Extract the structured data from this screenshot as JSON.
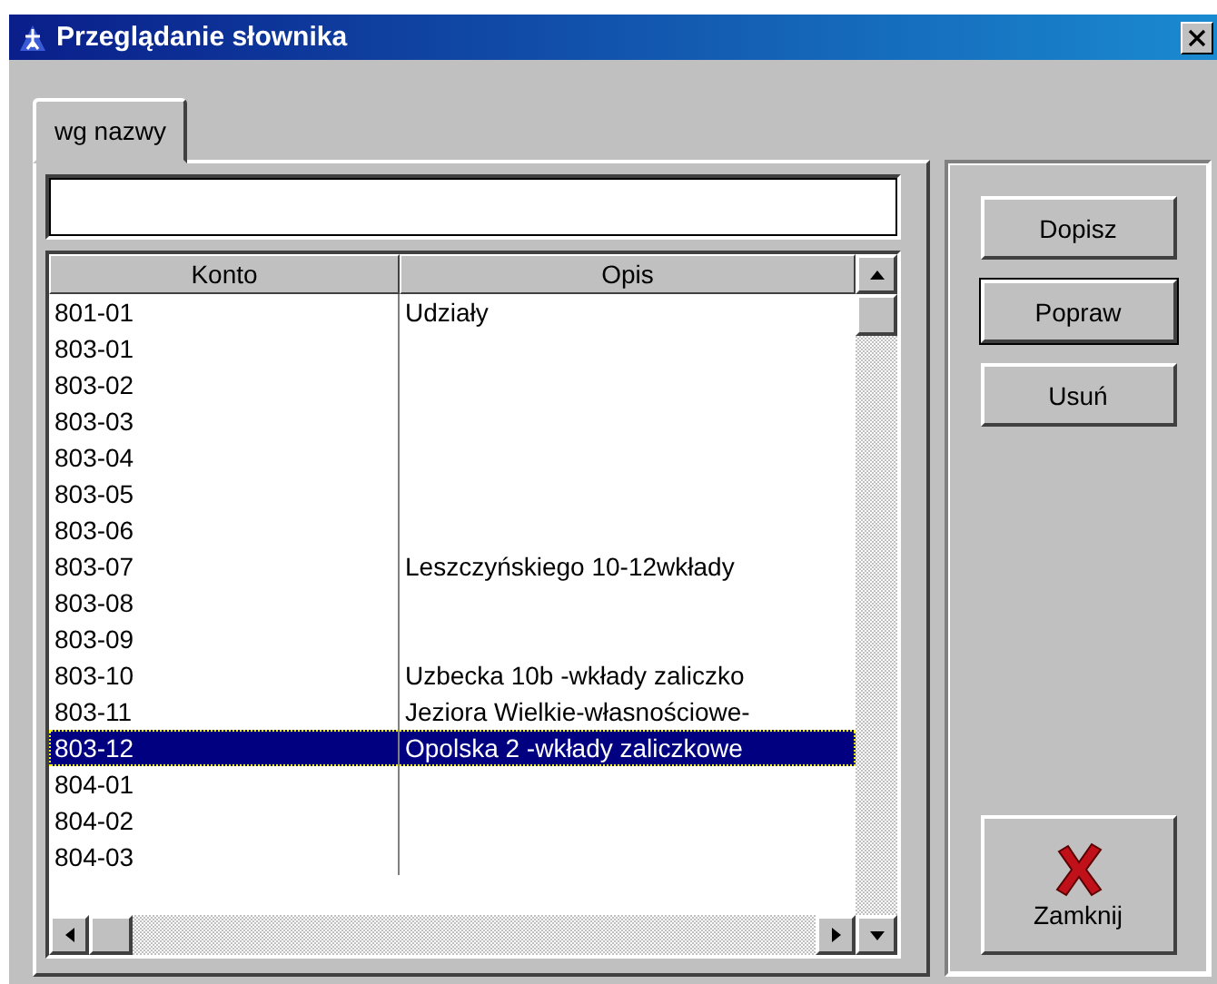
{
  "window": {
    "title": "Przeglądanie słownika"
  },
  "tabs": [
    {
      "label": "wg nazwy",
      "selected": true
    }
  ],
  "table": {
    "columns": [
      "Konto",
      "Opis"
    ],
    "rows": [
      {
        "konto": "801-01",
        "opis": "Udziały",
        "selected": false
      },
      {
        "konto": "803-01",
        "opis": "",
        "selected": false
      },
      {
        "konto": "803-02",
        "opis": "",
        "selected": false
      },
      {
        "konto": "803-03",
        "opis": "",
        "selected": false
      },
      {
        "konto": "803-04",
        "opis": "",
        "selected": false
      },
      {
        "konto": "803-05",
        "opis": "",
        "selected": false
      },
      {
        "konto": "803-06",
        "opis": "",
        "selected": false
      },
      {
        "konto": "803-07",
        "opis": "Leszczyńskiego 10-12wkłady",
        "selected": false
      },
      {
        "konto": "803-08",
        "opis": "",
        "selected": false
      },
      {
        "konto": "803-09",
        "opis": "",
        "selected": false
      },
      {
        "konto": "803-10",
        "opis": "Uzbecka 10b -wkłady zaliczko",
        "selected": false
      },
      {
        "konto": "803-11",
        "opis": "Jeziora Wielkie-własnościowe-",
        "selected": false
      },
      {
        "konto": "803-12",
        "opis": "Opolska 2 -wkłady zaliczkowe",
        "selected": true
      },
      {
        "konto": "804-01",
        "opis": "",
        "selected": false
      },
      {
        "konto": "804-02",
        "opis": "",
        "selected": false
      },
      {
        "konto": "804-03",
        "opis": "",
        "selected": false
      }
    ]
  },
  "buttons": [
    {
      "label": "Dopisz",
      "kind": "plain",
      "default": false
    },
    {
      "label": "Popraw",
      "kind": "plain",
      "default": true
    },
    {
      "label": "Usuń",
      "kind": "plain",
      "default": false
    },
    {
      "label": "Zamknij",
      "kind": "close",
      "default": false
    }
  ]
}
